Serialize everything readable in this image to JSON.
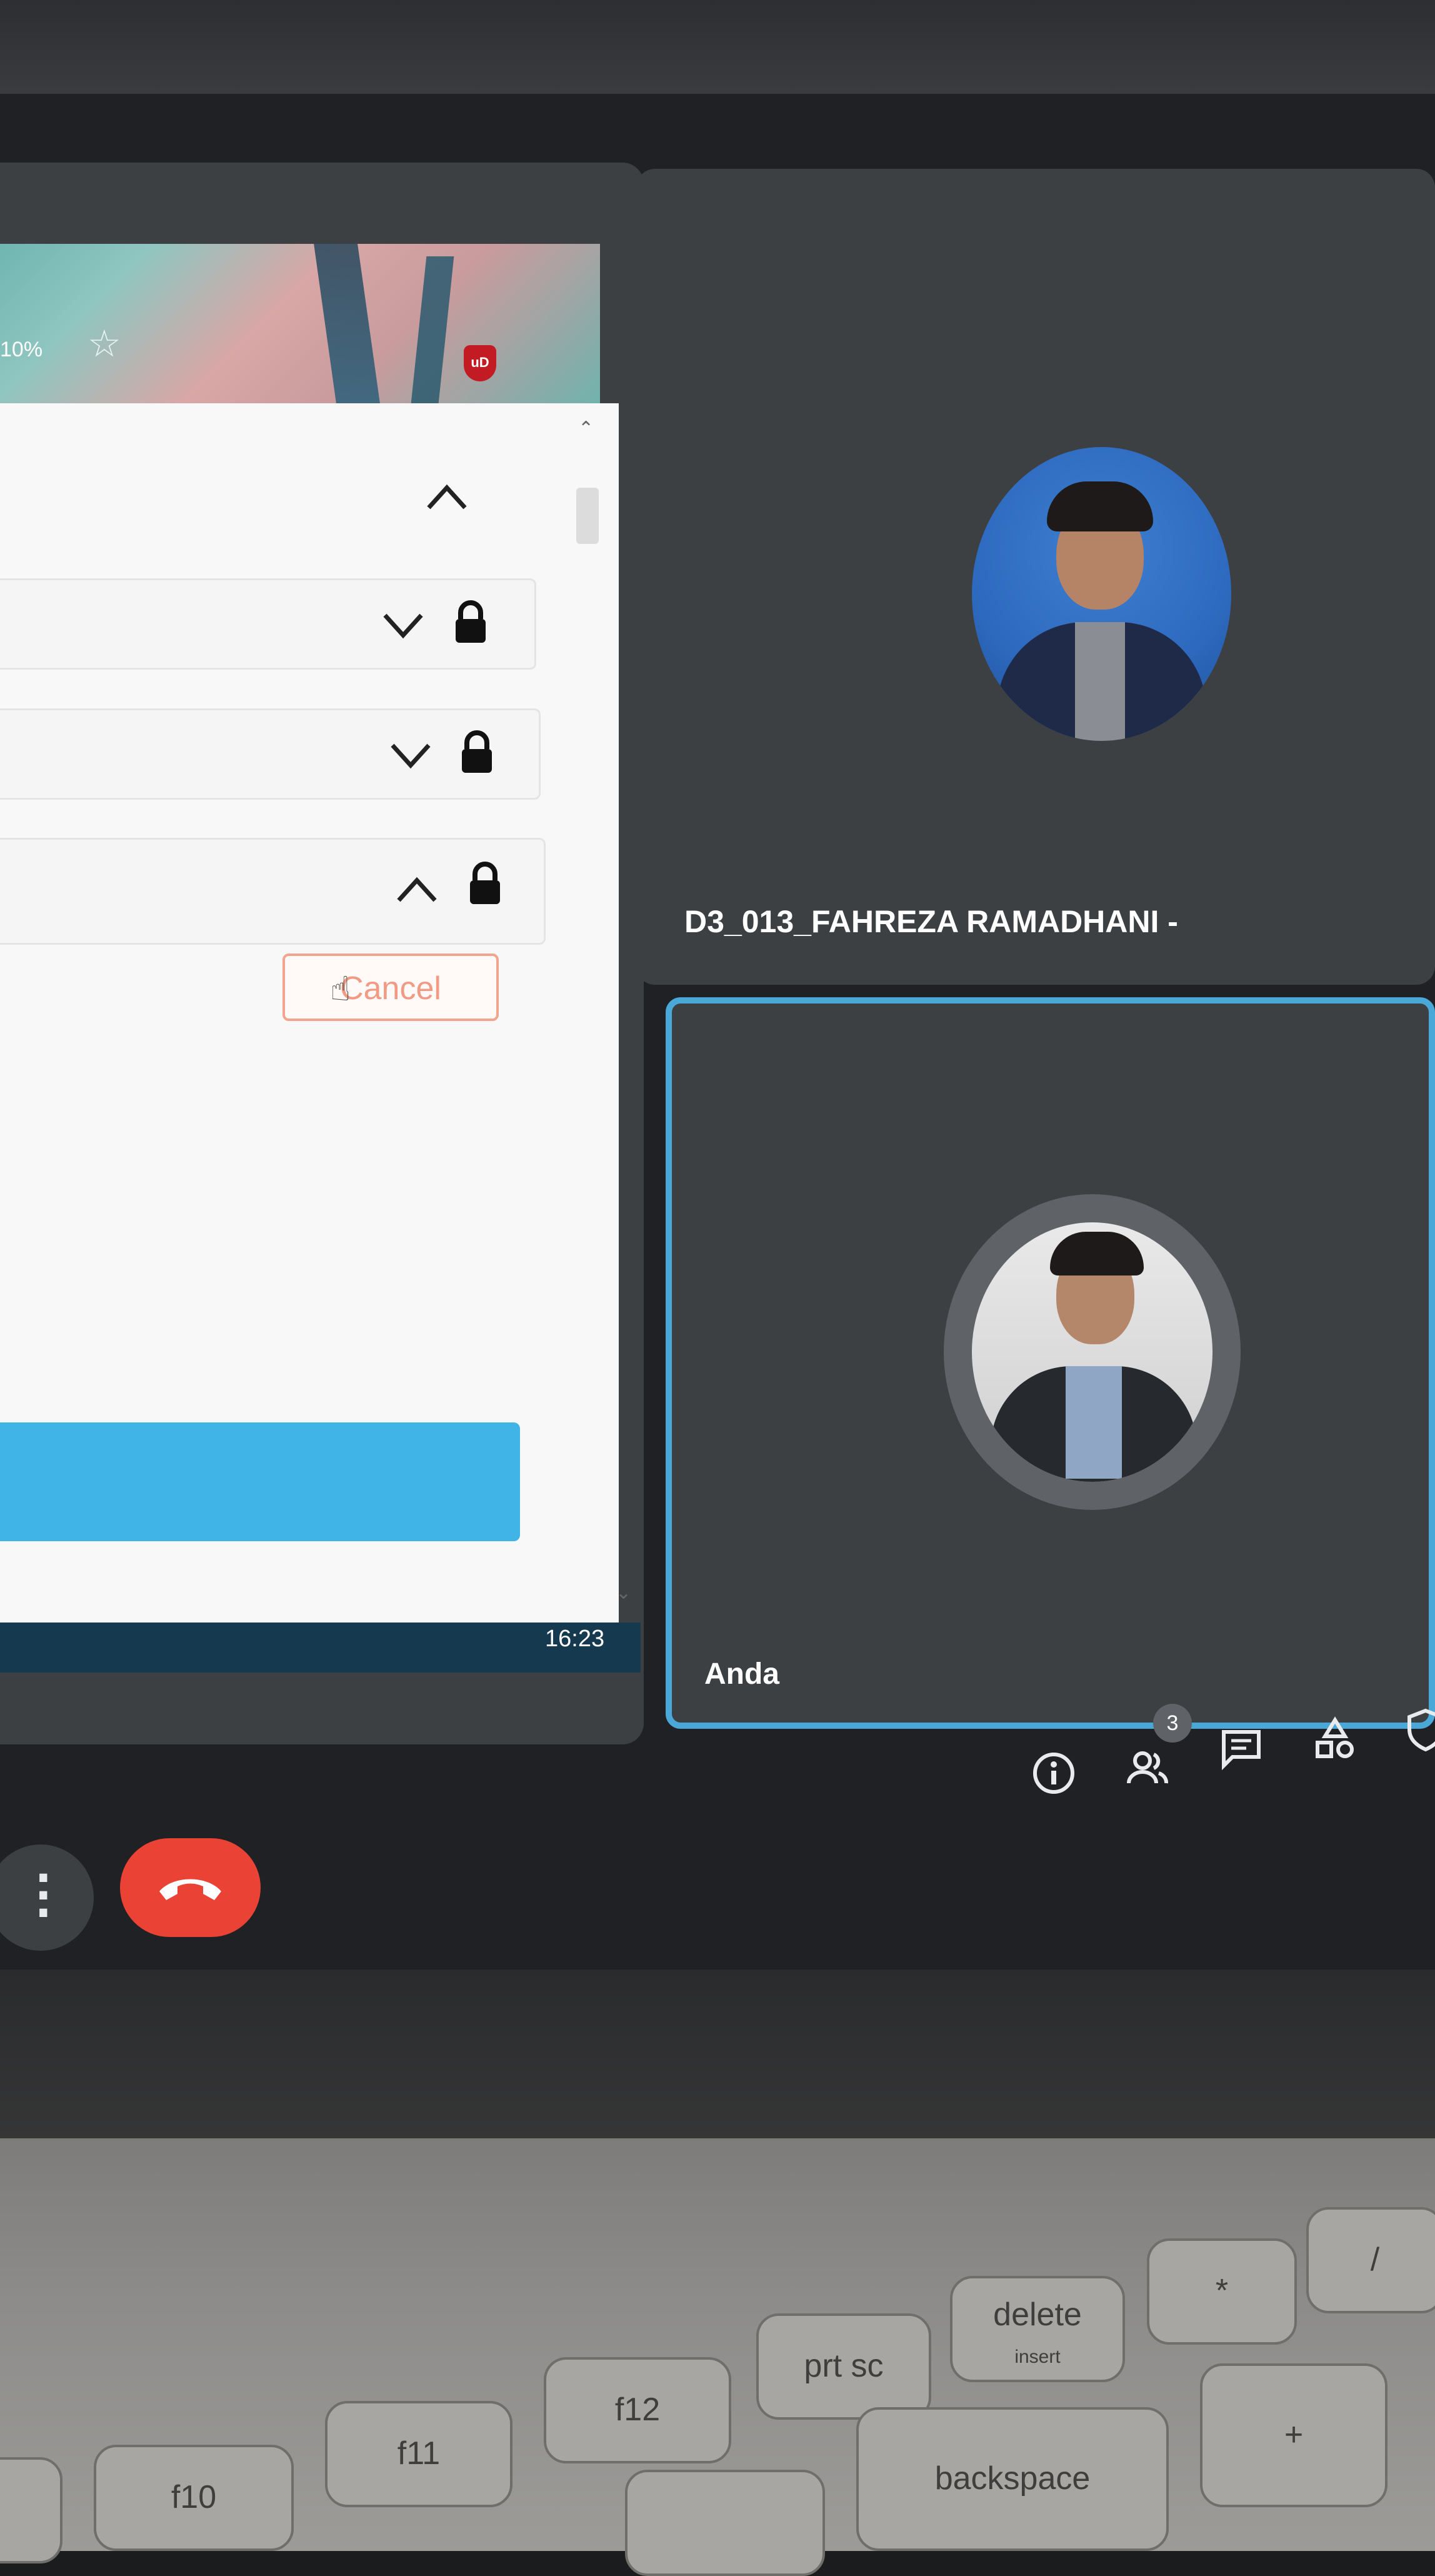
{
  "shared_window": {
    "zoom_text": "10%",
    "cancel_label": "Cancel",
    "taskbar_clock": "16:23",
    "extension_badge": "uD"
  },
  "participants": [
    {
      "name": "D3_013_FAHREZA RAMADHANI -"
    },
    {
      "name": "Anda"
    }
  ],
  "controls": {
    "participant_count": "3"
  },
  "keyboard": {
    "f10": "f10",
    "f11": "f11",
    "f12": "f12",
    "prt_sc": "prt sc",
    "delete": "delete",
    "insert": "insert",
    "asterisk": "*",
    "slash": "/",
    "backspace": "backspace",
    "plus": "+"
  },
  "colors": {
    "accent_blue": "#40b4e6",
    "end_call_red": "#ea4335",
    "cancel_orange": "#f19b84",
    "tile_bg": "#3c4043"
  }
}
